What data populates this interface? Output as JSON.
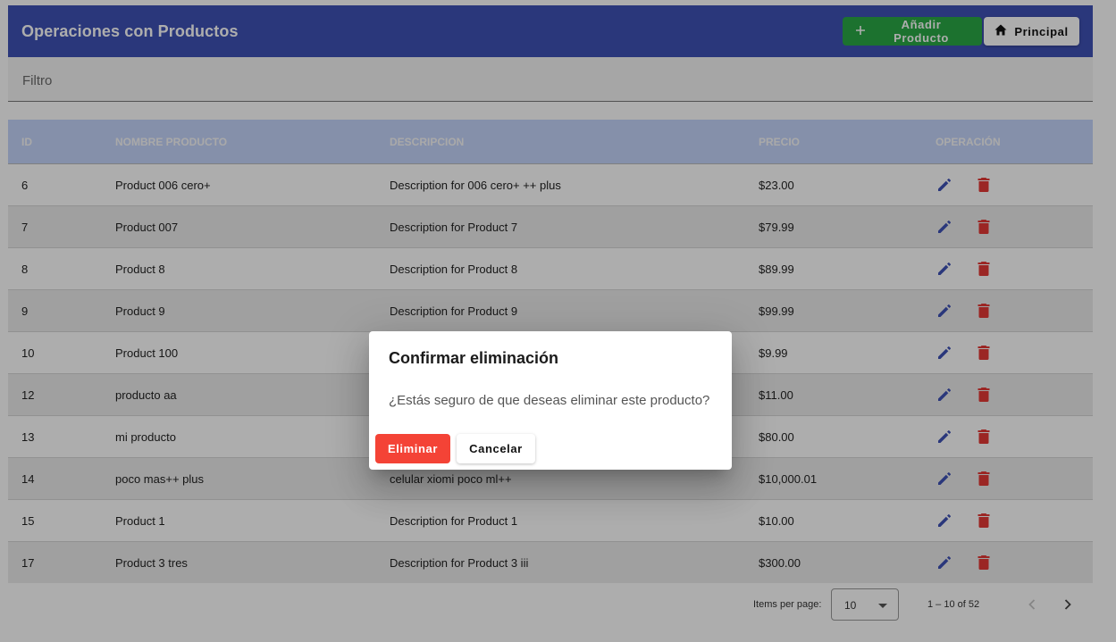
{
  "toolbar": {
    "title": "Operaciones con Productos",
    "add_button_label": "Añadir Producto",
    "home_button_label": "Principal",
    "color": "#3f51b5"
  },
  "filter": {
    "placeholder": "Filtro"
  },
  "table": {
    "headers": [
      "ID",
      "NOMBRE PRODUCTO",
      "DESCRIPCION",
      "PRECIO",
      "OPERACIÓN"
    ],
    "rows": [
      {
        "id": "6",
        "name": "Product 006 cero+",
        "description": "Description for 006 cero+ ++ plus",
        "price": "$23.00"
      },
      {
        "id": "7",
        "name": "Product 007",
        "description": "Description for Product 7",
        "price": "$79.99"
      },
      {
        "id": "8",
        "name": "Product 8",
        "description": "Description for Product 8",
        "price": "$89.99"
      },
      {
        "id": "9",
        "name": "Product 9",
        "description": "Description for Product 9",
        "price": "$99.99"
      },
      {
        "id": "10",
        "name": "Product 100",
        "description": "",
        "price": "$9.99"
      },
      {
        "id": "12",
        "name": "producto aa",
        "description": "",
        "price": "$11.00"
      },
      {
        "id": "13",
        "name": "mi producto",
        "description": "",
        "price": "$80.00"
      },
      {
        "id": "14",
        "name": "poco mas++ plus",
        "description": "celular xiomi poco ml++",
        "price": "$10,000.01"
      },
      {
        "id": "15",
        "name": "Product 1",
        "description": "Description for Product 1",
        "price": "$10.00"
      },
      {
        "id": "17",
        "name": "Product 3 tres",
        "description": "Description for Product 3 iii",
        "price": "$300.00"
      }
    ]
  },
  "paginator": {
    "items_per_page_label": "Items per page:",
    "items_per_page_value": "10",
    "range_label": "1 – 10 of 52"
  },
  "dialog": {
    "title": "Confirmar eliminación",
    "message": "¿Estás seguro de que deseas eliminar este producto?",
    "delete_label": "Eliminar",
    "cancel_label": "Cancelar"
  },
  "colors": {
    "edit_icon": "#3f51b5",
    "delete_icon": "#e53935",
    "delete_button": "#f44336",
    "add_button": "#2aa946"
  }
}
